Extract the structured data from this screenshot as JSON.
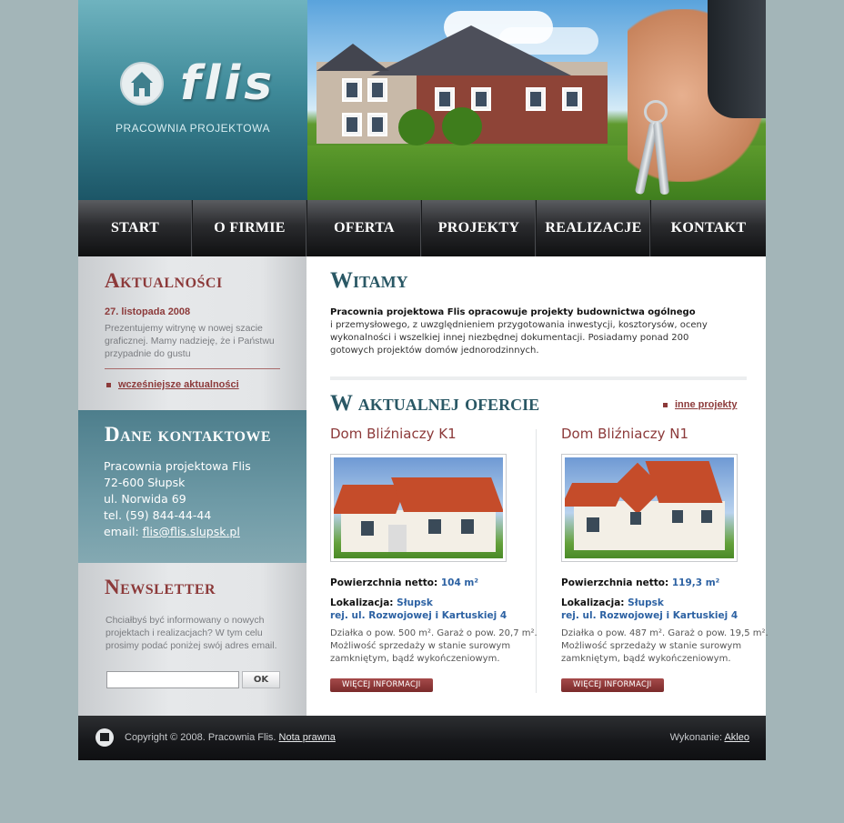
{
  "header": {
    "logo_text": "flis",
    "logo_subtitle": "PRACOWNIA PROJEKTOWA"
  },
  "nav": {
    "items": [
      "START",
      "O FIRMIE",
      "OFERTA",
      "PROJEKTY",
      "REALIZACJE",
      "KONTAKT"
    ]
  },
  "news": {
    "title": "Aktualności",
    "date": "27. listopada 2008",
    "text": "Prezentujemy witrynę w nowej szacie graficznej. Mamy nadzieję, że i Państwu przypadnie do gustu",
    "link": "wcześniejsze aktualności"
  },
  "contact": {
    "title": "Dane kontaktowe",
    "company": "Pracownia projektowa Flis",
    "city": "72-600 Słupsk",
    "street": "ul. Norwida 69",
    "phone": "tel. (59) 844-44-44",
    "email_label": "email: ",
    "email": "flis@flis.slupsk.pl"
  },
  "newsletter": {
    "title": "Newsletter",
    "text": "Chciałbyś być informowany o nowych projektach i realizacjach? W tym celu prosimy podać poniżej swój adres email.",
    "input_value": "",
    "button": "OK"
  },
  "main": {
    "title": "Witamy",
    "intro_bold": "Pracownia projektowa Flis opracowuje projekty budownictwa ogólnego",
    "intro_rest": "i przemysłowego, z uwzględnieniem przygotowania inwestycji, kosztorysów, oceny wykonalności i wszelkiej innej niezbędnej dokumentacji. Posiadamy ponad 200 gotowych projektów domów jednorodzinnych.",
    "offers_title": "W aktualnej ofercie",
    "other_projects_link": "inne projekty",
    "offers": [
      {
        "name": "Dom Bliźniaczy K1",
        "area_label": "Powierzchnia netto: ",
        "area": "104 m²",
        "location_label": "Lokalizacja: ",
        "city": "Słupsk",
        "location_detail": "rej. ul. Rozwojowej i Kartuskiej 4",
        "description": "Działka o pow. 500 m². Garaż o pow. 20,7 m². Możliwość sprzedaży w stanie surowym zamkniętym, bądź wykończeniowym.",
        "button": "WIĘCEJ INFORMACJI"
      },
      {
        "name": "Dom Bliźniaczy N1",
        "area_label": "Powierzchnia netto: ",
        "area": "119,3 m²",
        "location_label": "Lokalizacja: ",
        "city": "Słupsk",
        "location_detail": "rej. ul. Rozwojowej i Kartuskiej 4",
        "description": "Działka o pow. 487 m². Garaż o pow. 19,5 m². Możliwość sprzedaży w stanie surowym zamkniętym, bądź wykończeniowym.",
        "button": "WIĘCEJ INFORMACJI"
      }
    ]
  },
  "footer": {
    "copyright": "Copyright © 2008. Pracownia Flis. ",
    "legal_link": "Nota prawna",
    "made_by_label": "Wykonanie: ",
    "made_by_link": "Akleo"
  },
  "colors": {
    "accent_red": "#8c3a3a",
    "teal": "#2a5865",
    "link_blue": "#2d62a3"
  }
}
